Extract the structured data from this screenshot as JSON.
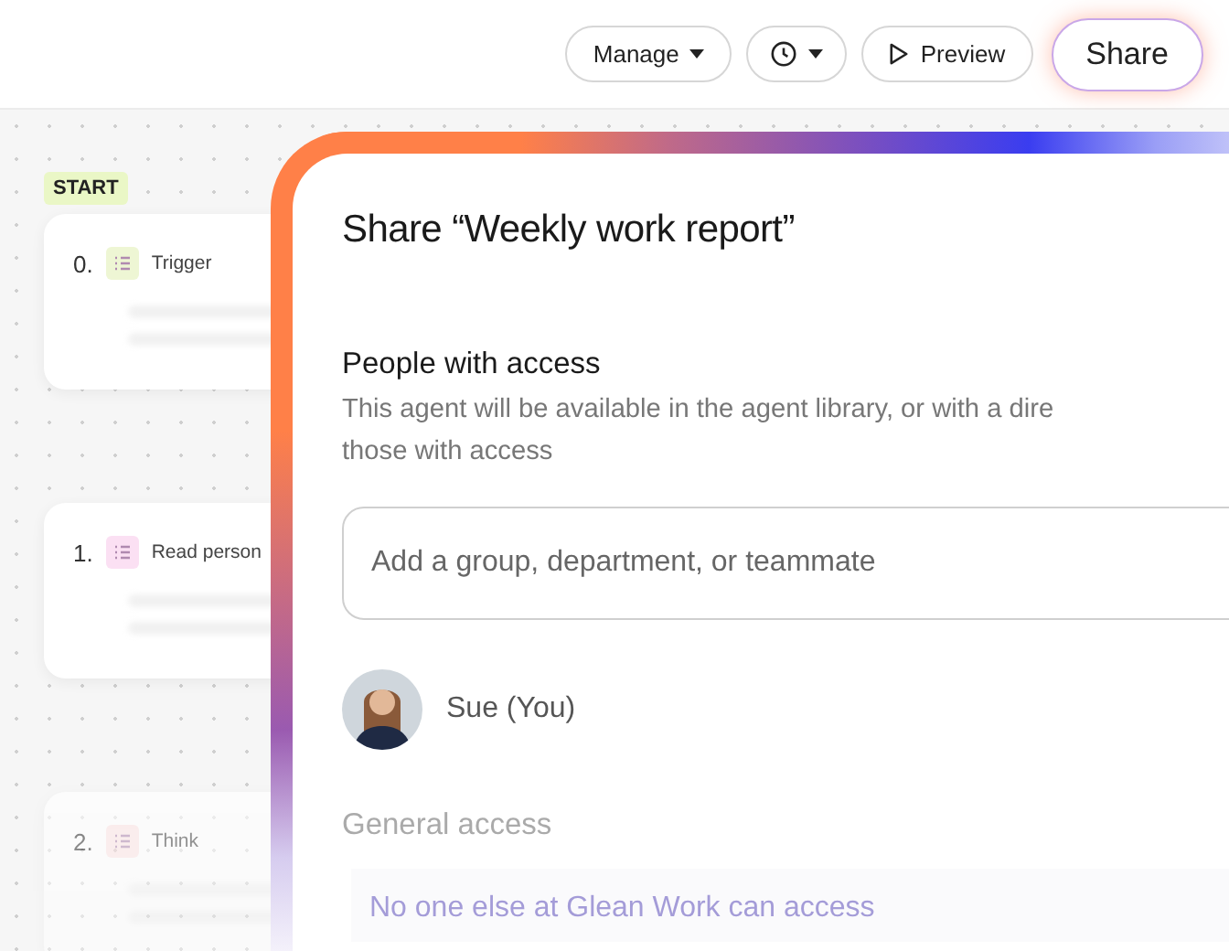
{
  "toolbar": {
    "buttons": [
      {
        "kind": "menu",
        "label": "Manage"
      },
      {
        "kind": "history"
      },
      {
        "kind": "play",
        "label": "Preview"
      },
      {
        "kind": "primary",
        "label": "Share"
      }
    ]
  },
  "canvas": {
    "start_tag": "START",
    "steps": [
      {
        "number": "0.",
        "label": "Trigger",
        "color": "#eef6d4"
      },
      {
        "number": "1.",
        "label": "Read person",
        "color": "#fbe0f3"
      },
      {
        "number": "2.",
        "label": "Think",
        "color": "#fde6e6"
      }
    ]
  },
  "dialog": {
    "title": "Share “Weekly work report”",
    "people_heading": "People with access",
    "people_description": [
      "This agent will be available in the agent library, or with a dire",
      "those with access"
    ],
    "search": {
      "placeholder": "Add a group, department, or teammate"
    },
    "members": [
      {
        "name": "Sue (You)"
      }
    ],
    "general_heading": "General access",
    "general_option": "No one else at Glean Work can access"
  }
}
